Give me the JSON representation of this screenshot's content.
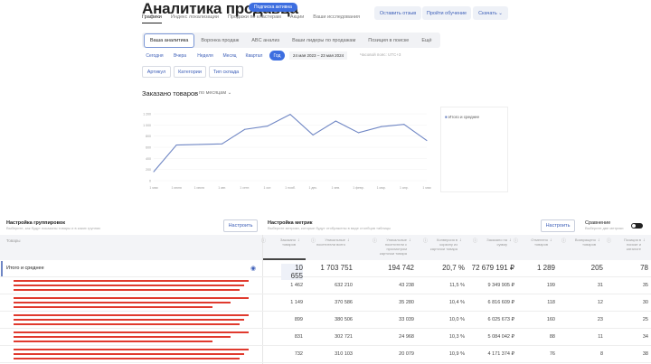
{
  "header": {
    "title": "Аналитика продавца",
    "badge": "Подписка активна",
    "tabs": [
      "Графики",
      "Индекс локализации",
      "Продажи по кластерам",
      "Акции",
      "Ваши исследования"
    ],
    "buttons": {
      "feedback": "Оставить отзыв",
      "training": "Пройти обучение",
      "download": "Скачать"
    }
  },
  "sections": [
    "Ваша аналитика",
    "Воронка продаж",
    "ABC анализ",
    "Ваши лидеры по продажам",
    "Позиция в поиске",
    "Ещё"
  ],
  "periods": [
    "Сегодня",
    "Вчера",
    "Неделя",
    "Месяц",
    "Квартал",
    "Год"
  ],
  "date_range": {
    "from": "24 мая 2023",
    "sep": "–",
    "to": "23 мая 2024",
    "tz": "Часовой пояс: UTC+3"
  },
  "filters": [
    "Артикул",
    "Категории",
    "Тип склада"
  ],
  "chart_data": {
    "type": "line",
    "title": "Заказано товаров",
    "grouping": "по месяцам",
    "x": [
      "1 мая",
      "1 июня",
      "1 июля",
      "1 авг.",
      "1 сент.",
      "1 окт.",
      "1 нояб.",
      "1 дек.",
      "1 янв.",
      "1 февр.",
      "1 мар.",
      "1 апр.",
      "1 мая"
    ],
    "series": [
      {
        "name": "Итого и среднее",
        "values": [
          160,
          640,
          650,
          660,
          920,
          980,
          1190,
          820,
          1070,
          860,
          970,
          1010,
          720
        ]
      }
    ],
    "yticks": [
      "0",
      "200",
      "400",
      "600",
      "800",
      "1 000",
      "1 200"
    ],
    "ylim": [
      0,
      1200
    ],
    "color": "#6f86c4",
    "legend": "right"
  },
  "grouping": {
    "title": "Настройка группировок",
    "subtitle": "Выберите, как будут показаны товары и в каких группах",
    "button": "Настроить"
  },
  "metrics": {
    "title": "Настройка метрик",
    "subtitle": "Выберите метрики, которые будут отображены в виде столбцов таблицы",
    "button": "Настроить"
  },
  "compare": {
    "title": "Сравнение",
    "subtitle": "Выберите две метрики"
  },
  "table": {
    "first_col": "Товары",
    "headers": [
      "Заказано товаров",
      "Уникальные посетители всего",
      "Уникальные посетители с просмотром карточки товара",
      "Конверсия в корзину из карточки товара",
      "Заказано на сумму",
      "Отменено товаров",
      "Возвращено товаров",
      "Позиция в поиске и каталоге"
    ],
    "total": {
      "label": "Итого и среднее",
      "values": [
        "10 655",
        "1 703 751",
        "194 742",
        "20,7 %",
        "72 679 191 ₽",
        "1 289",
        "205",
        "78"
      ]
    },
    "rows": [
      [
        "1 462",
        "632 210",
        "43 238",
        "11,5 %",
        "9 349 905 ₽",
        "199",
        "31",
        "35"
      ],
      [
        "1 149",
        "370 586",
        "35 280",
        "10,4 %",
        "6 816 609 ₽",
        "118",
        "12",
        "30"
      ],
      [
        "899",
        "380 506",
        "33 039",
        "10,0 %",
        "6 025 673 ₽",
        "160",
        "23",
        "25"
      ],
      [
        "831",
        "302 721",
        "24 968",
        "10,3 %",
        "5 084 042 ₽",
        "88",
        "11",
        "34"
      ],
      [
        "732",
        "310 103",
        "20 079",
        "10,9 %",
        "4 171 374 ₽",
        "76",
        "8",
        "38"
      ]
    ]
  }
}
